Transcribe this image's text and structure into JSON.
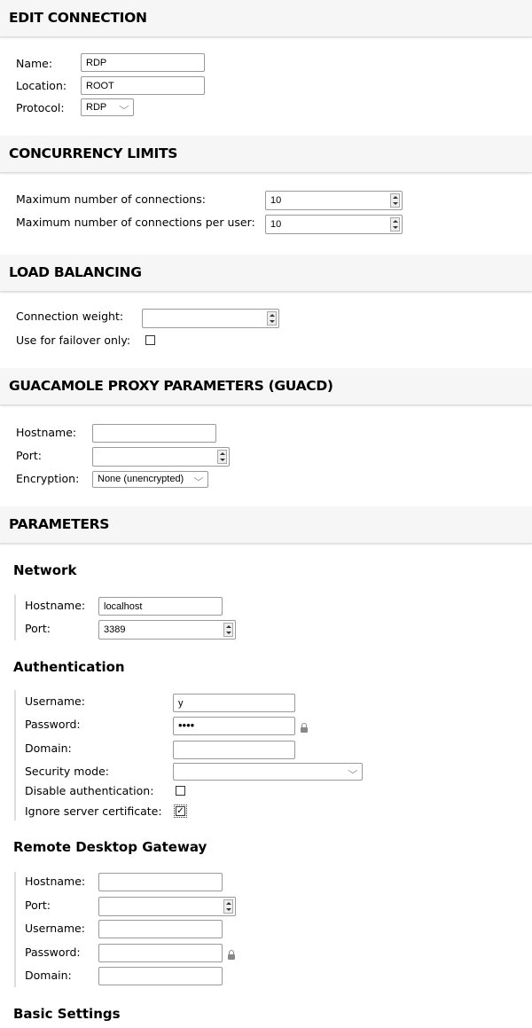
{
  "edit_connection": {
    "title": "EDIT CONNECTION",
    "name_label": "Name:",
    "name_value": "RDP",
    "location_label": "Location:",
    "location_value": "ROOT",
    "protocol_label": "Protocol:",
    "protocol_value": "RDP"
  },
  "concurrency": {
    "title": "CONCURRENCY LIMITS",
    "max_label": "Maximum number of connections:",
    "max_value": "10",
    "max_user_label": "Maximum number of connections per user:",
    "max_user_value": "10"
  },
  "load_balancing": {
    "title": "LOAD BALANCING",
    "weight_label": "Connection weight:",
    "weight_value": "",
    "failover_label": "Use for failover only:",
    "failover_checked": false
  },
  "guacd": {
    "title": "GUACAMOLE PROXY PARAMETERS (GUACD)",
    "hostname_label": "Hostname:",
    "hostname_value": "",
    "port_label": "Port:",
    "port_value": "",
    "encryption_label": "Encryption:",
    "encryption_value": "None (unencrypted)"
  },
  "parameters": {
    "title": "PARAMETERS",
    "network": {
      "title": "Network",
      "hostname_label": "Hostname:",
      "hostname_value": "localhost",
      "port_label": "Port:",
      "port_value": "3389"
    },
    "authentication": {
      "title": "Authentication",
      "username_label": "Username:",
      "username_value": "y",
      "password_label": "Password:",
      "password_value": "••••",
      "domain_label": "Domain:",
      "domain_value": "",
      "security_label": "Security mode:",
      "security_value": "",
      "disable_auth_label": "Disable authentication:",
      "disable_auth_checked": false,
      "ignore_cert_label": "Ignore server certificate:",
      "ignore_cert_checked": true
    },
    "gateway": {
      "title": "Remote Desktop Gateway",
      "hostname_label": "Hostname:",
      "port_label": "Port:",
      "username_label": "Username:",
      "password_label": "Password:",
      "domain_label": "Domain:"
    },
    "basic": {
      "title": "Basic Settings"
    }
  },
  "icons": {
    "checkmark": "✓",
    "chevron": "⌵"
  }
}
